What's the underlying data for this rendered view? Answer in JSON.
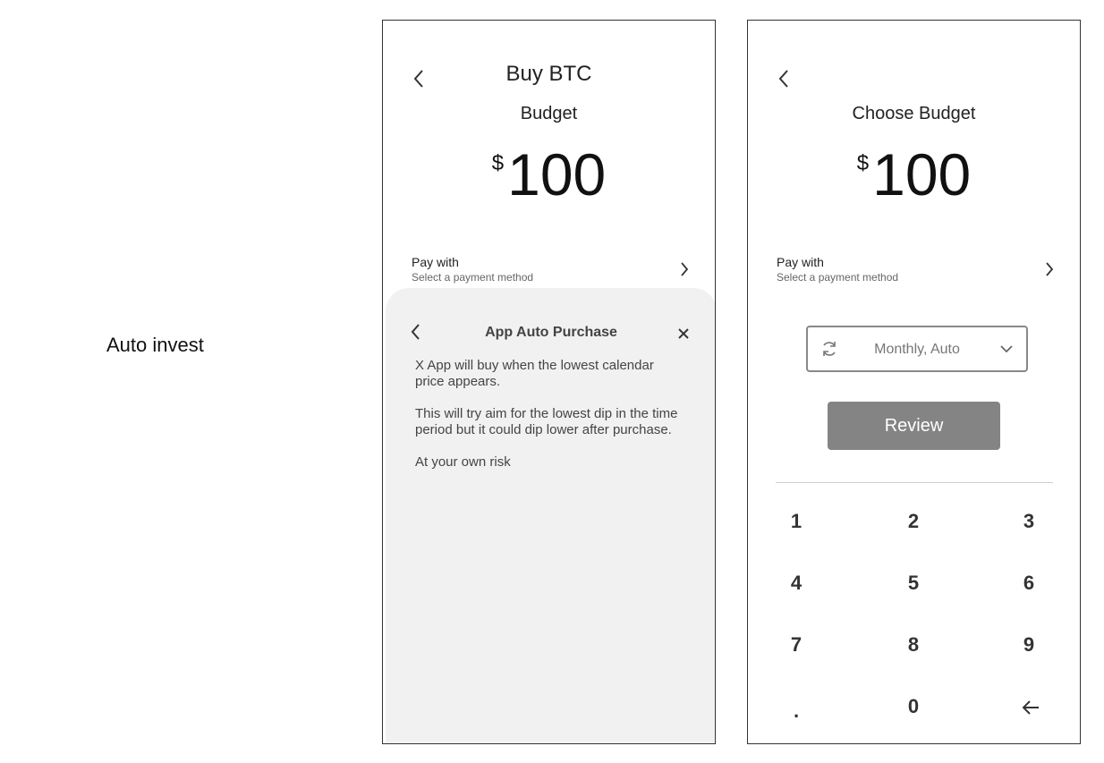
{
  "section_label": "Auto invest",
  "screen1": {
    "title": "Buy BTC",
    "budget_label": "Budget",
    "currency": "$",
    "amount": "100",
    "pay_with": {
      "title": "Pay with",
      "subtitle": "Select a payment method"
    },
    "sheet": {
      "title": "App Auto Purchase",
      "paragraphs": [
        "X App will buy when the lowest calendar price appears.",
        "This will try aim for the lowest dip in the time period but it could dip lower after purchase.",
        "At your own risk"
      ]
    }
  },
  "screen2": {
    "budget_label": "Choose Budget",
    "currency": "$",
    "amount": "100",
    "pay_with": {
      "title": "Pay with",
      "subtitle": "Select a payment method"
    },
    "frequency_select": {
      "value": "Monthly,  Auto"
    },
    "review_label": "Review",
    "keypad": [
      "1",
      "2",
      "3",
      "4",
      "5",
      "6",
      "7",
      "8",
      "9",
      ".",
      "0"
    ]
  },
  "icons": {
    "back": "chevron-left-icon",
    "close": "close-icon",
    "chevron_right": "chevron-right-icon",
    "chevron_down": "chevron-down-icon",
    "refresh": "refresh-icon",
    "backspace": "backspace-arrow-icon"
  },
  "colors": {
    "sheet_bg": "#f1f1f1",
    "review_bg": "#848484",
    "border": "#333333"
  }
}
